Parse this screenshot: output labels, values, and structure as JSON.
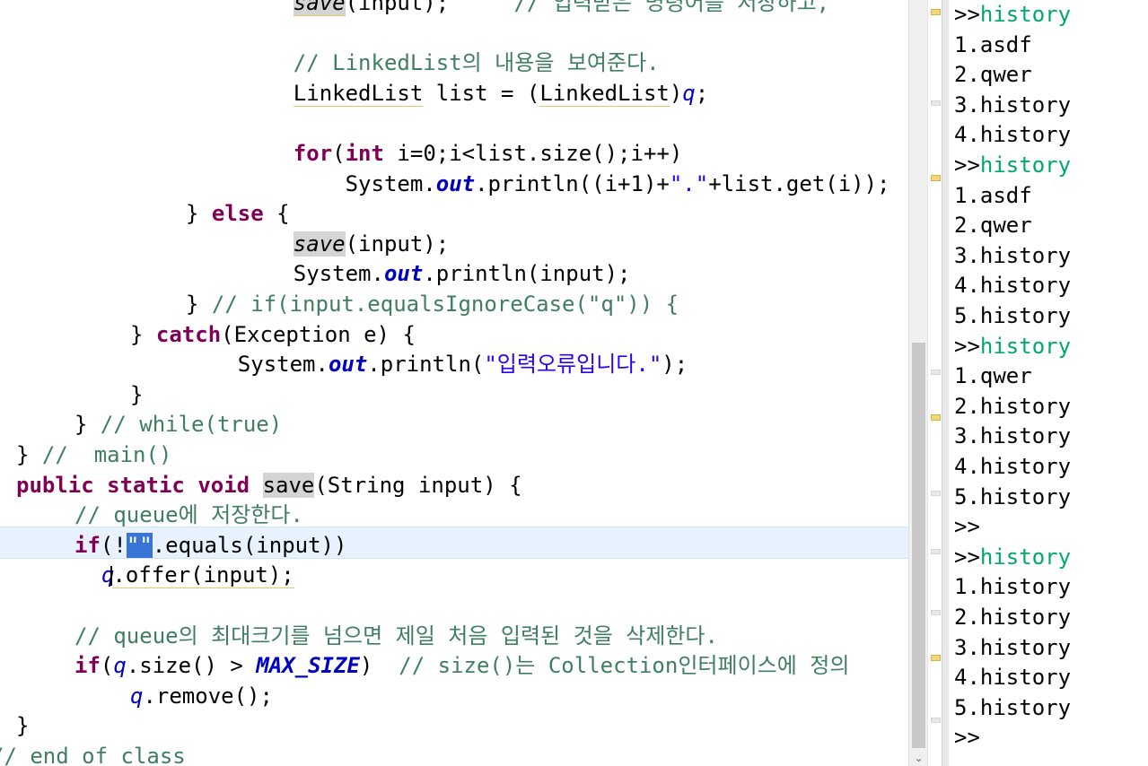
{
  "editor": {
    "lines": [
      {
        "parts": [
          {
            "t": "    "
          },
          {
            "t": "save",
            "c": "it gr ul"
          },
          {
            "t": "(input);     "
          },
          {
            "t": "// 입력받은 명령어를 저장하고,",
            "c": "cm"
          }
        ]
      },
      {
        "parts": [
          {
            "t": ""
          }
        ]
      },
      {
        "parts": [
          {
            "t": "    "
          },
          {
            "t": "// LinkedList의 내용을 보여준다.",
            "c": "cm"
          }
        ]
      },
      {
        "parts": [
          {
            "t": "    "
          },
          {
            "t": "LinkedList",
            "c": "ul"
          },
          {
            "t": " list = ("
          },
          {
            "t": "LinkedList",
            "c": "ul"
          },
          {
            "t": ")"
          },
          {
            "t": "q",
            "c": "var"
          },
          {
            "t": ";"
          }
        ]
      },
      {
        "parts": [
          {
            "t": ""
          }
        ]
      },
      {
        "parts": [
          {
            "t": "    "
          },
          {
            "t": "for",
            "c": "kw"
          },
          {
            "t": "("
          },
          {
            "t": "int",
            "c": "kw"
          },
          {
            "t": " i=0;i<list.size();i++)"
          }
        ]
      },
      {
        "parts": [
          {
            "t": "        System."
          },
          {
            "t": "out",
            "c": "fld"
          },
          {
            "t": ".println((i+1)+"
          },
          {
            "t": "\".\"",
            "c": "st"
          },
          {
            "t": "+list.get(i));"
          }
        ]
      },
      {
        "parts": [
          {
            "t": "} "
          },
          {
            "t": "else",
            "c": "kw"
          },
          {
            "t": " {"
          }
        ]
      },
      {
        "parts": [
          {
            "t": "    "
          },
          {
            "t": "save",
            "c": "it gr"
          },
          {
            "t": "(input);"
          }
        ]
      },
      {
        "parts": [
          {
            "t": "    System."
          },
          {
            "t": "out",
            "c": "fld"
          },
          {
            "t": ".println(input);"
          }
        ]
      },
      {
        "parts": [
          {
            "t": "} "
          },
          {
            "t": "// if(input.equalsIgnoreCase(\"q\")) {",
            "c": "cm"
          }
        ]
      },
      {
        "parts": [
          {
            "t": "} "
          },
          {
            "t": "catch",
            "c": "kw"
          },
          {
            "t": "(Exception e) {"
          }
        ]
      },
      {
        "parts": [
          {
            "t": "    System."
          },
          {
            "t": "out",
            "c": "fld"
          },
          {
            "t": ".println("
          },
          {
            "t": "\"입력오류입니다.\"",
            "c": "st"
          },
          {
            "t": ");"
          }
        ]
      },
      {
        "parts": [
          {
            "t": "}"
          }
        ]
      },
      {
        "parts": [
          {
            "t": "} "
          },
          {
            "t": "// while(true)",
            "c": "cm"
          }
        ]
      },
      {
        "parts": [
          {
            "t": "} "
          },
          {
            "t": "//  main()",
            "c": "cm"
          }
        ]
      },
      {
        "parts": [
          {
            "t": "public",
            "c": "kw"
          },
          {
            "t": " "
          },
          {
            "t": "static",
            "c": "kw"
          },
          {
            "t": " "
          },
          {
            "t": "void",
            "c": "kw"
          },
          {
            "t": " "
          },
          {
            "t": "save",
            "c": "gr"
          },
          {
            "t": "(String input) {"
          }
        ]
      },
      {
        "parts": [
          {
            "t": "// queue에 저장한다.",
            "c": "cm"
          }
        ]
      },
      {
        "parts": [
          {
            "t": "if",
            "c": "kw"
          },
          {
            "t": "(!"
          },
          {
            "t": "\"\"",
            "c": "sel"
          },
          {
            "t": ".equals(input))"
          }
        ]
      },
      {
        "parts": [
          {
            "t": "q",
            "c": "var"
          },
          {
            "t": ".offer(input);",
            "c": "ul"
          }
        ]
      },
      {
        "parts": [
          {
            "t": ""
          }
        ]
      },
      {
        "parts": [
          {
            "t": "// queue의 최대크기를 넘으면 제일 처음 입력된 것을 삭제한다.",
            "c": "cm"
          }
        ]
      },
      {
        "parts": [
          {
            "t": "if",
            "c": "kw"
          },
          {
            "t": "("
          },
          {
            "t": "q",
            "c": "var"
          },
          {
            "t": ".size() > "
          },
          {
            "t": "MAX_SIZE",
            "c": "const"
          },
          {
            "t": ")  "
          },
          {
            "t": "// size()는 Collection인터페이스에 정의",
            "c": "cm"
          }
        ]
      },
      {
        "parts": [
          {
            "t": "q",
            "c": "var"
          },
          {
            "t": ".remove();"
          }
        ]
      },
      {
        "parts": [
          {
            "t": "}"
          }
        ]
      },
      {
        "parts": [
          {
            "t": "// end of class",
            "c": "cm"
          }
        ]
      }
    ]
  },
  "console": {
    "lines": [
      {
        "prompt": ">>",
        "input": "history"
      },
      {
        "text": "1.asdf"
      },
      {
        "text": "2.qwer"
      },
      {
        "text": "3.history"
      },
      {
        "text": "4.history"
      },
      {
        "prompt": ">>",
        "input": "history"
      },
      {
        "text": "1.asdf"
      },
      {
        "text": "2.qwer"
      },
      {
        "text": "3.history"
      },
      {
        "text": "4.history"
      },
      {
        "text": "5.history"
      },
      {
        "prompt": ">>",
        "input": "history"
      },
      {
        "text": "1.qwer"
      },
      {
        "text": "2.history"
      },
      {
        "text": "3.history"
      },
      {
        "text": "4.history"
      },
      {
        "text": "5.history"
      },
      {
        "prompt": ">>",
        "input": ""
      },
      {
        "prompt": ">>",
        "input": "history"
      },
      {
        "text": "1.history"
      },
      {
        "text": "2.history"
      },
      {
        "text": "3.history"
      },
      {
        "text": "4.history"
      },
      {
        "text": "5.history"
      },
      {
        "prompt": ">>",
        "input": ""
      }
    ]
  },
  "scrollbar": {
    "down_arrow": "⌄"
  }
}
